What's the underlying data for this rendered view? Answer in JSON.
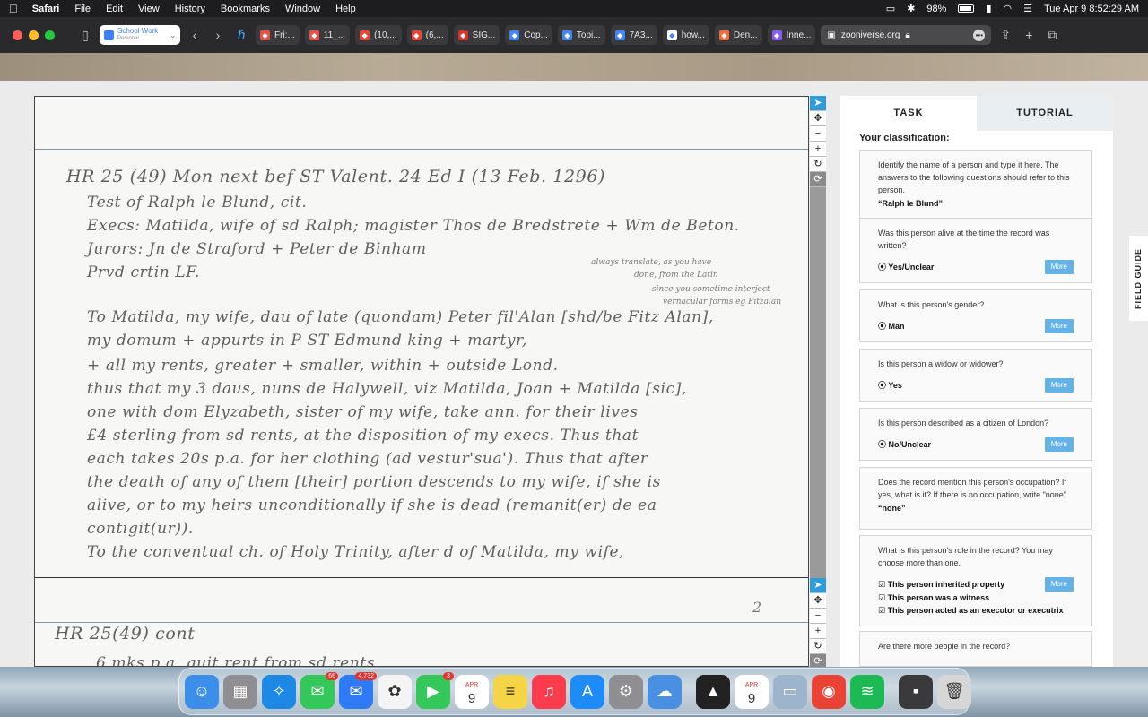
{
  "menubar": {
    "app": "Safari",
    "items": [
      "File",
      "Edit",
      "View",
      "History",
      "Bookmarks",
      "Window",
      "Help"
    ],
    "battery": "98%",
    "datetime": "Tue Apr 9  8:52:29 AM"
  },
  "toolbar": {
    "profile_name": "School Work",
    "profile_sub": "Personal",
    "tabs": [
      {
        "label": "Fri:...",
        "color": "#e8504a"
      },
      {
        "label": "11_...",
        "color": "#e8504a"
      },
      {
        "label": "(10,...",
        "color": "#ea4335"
      },
      {
        "label": "(6,...",
        "color": "#ea4335"
      },
      {
        "label": "SIG...",
        "color": "#d93025"
      },
      {
        "label": "Cop...",
        "color": "#4285f4"
      },
      {
        "label": "Topi...",
        "color": "#4285f4"
      },
      {
        "label": "7A3...",
        "color": "#4285f4"
      },
      {
        "label": "how...",
        "color": "#ffffff"
      },
      {
        "label": "Den...",
        "color": "#f26b3a"
      },
      {
        "label": "Inne...",
        "color": "#8a5cf6"
      }
    ],
    "url": "zooniverse.org"
  },
  "document": {
    "card1_lines": [
      "HR 25 (49)  Mon next bef ST Valent.   24 Ed I                       (13 Feb. 1296)",
      "Test of Ralph le Blund, cit.",
      "Execs: Matilda, wife of sd Ralph; magister Thos de Bredstrete + Wm de Beton.",
      "Jurors: Jn de Straford + Peter de Binham",
      "Prvd crtin LF.",
      "To Matilda, my wife, dau of late (quondam) Peter fil'Alan [shd/be Fitz Alan],",
      "my domum + appurts in P ST Edmund king + martyr,",
      "+ all my rents, greater + smaller, within + outside Lond.",
      "thus that my 3 daus, nuns de Halywell, viz Matilda, Joan + Matilda [sic],",
      "one with dom Elyzabeth, sister of my wife, take ann. for their lives",
      "£4 sterling from sd rents, at the disposition of my execs. Thus that",
      "each takes 20s p.a. for her clothing (ad vestur'sua').  Thus that after",
      "the death of any of them [their] portion descends to my wife, if she is",
      "alive, or to my heirs unconditionally if she is dead (remanit(er) de ea",
      "contigit(ur)).",
      "To the conventual ch. of Holy Trinity, after d of Matilda, my wife,"
    ],
    "margin_note": [
      "always translate, as you have",
      "done, from the Latin",
      "since you sometime interject",
      "vernacular forms eg Fitzalan"
    ],
    "card2_lines": [
      "HR 25(49)  cont",
      "6 mks p.a. quit rent from sd rents"
    ],
    "card2_page_number": "2"
  },
  "viewer_tools": [
    "pointer-icon",
    "move-icon",
    "zoom-out-icon",
    "zoom-in-icon",
    "rotate-icon",
    "reset-icon"
  ],
  "panel": {
    "tab_task": "TASK",
    "tab_tutorial": "TUTORIAL",
    "heading": "Your classification:",
    "questions": [
      {
        "text": "Identify the name of a person and type it here. The answers to the following questions should refer to this person.",
        "answer": "“Ralph le Blund”",
        "more": false
      },
      {
        "text": "Was this person alive at the time the record was written?",
        "answer": "Yes/Unclear",
        "more": true
      },
      {
        "text": "What is this person's gender?",
        "answer": "Man",
        "more": true
      },
      {
        "text": "Is this person a widow or widower?",
        "answer": "Yes",
        "more": true
      },
      {
        "text": "Is this person described as a citizen of London?",
        "answer": "No/Unclear",
        "more": true
      },
      {
        "text": "Does the record mention this person's occupation? If yes, what is it? If there is no occupation, write \"none\".",
        "answer": "“none”",
        "more": false
      },
      {
        "text": "What is this person's role in the record? You may choose more than one.",
        "answers": [
          "This person inherited property",
          "This person was a witness",
          "This person acted as an executor or executrix"
        ],
        "more": true
      },
      {
        "text": "Are there more people in the record?",
        "more": false
      }
    ],
    "more_label": "More",
    "field_guide": "FIELD GUIDE"
  },
  "dock": {
    "apps": [
      {
        "name": "finder-icon",
        "color": "#3b8fe8",
        "glyph": "☺"
      },
      {
        "name": "launchpad-icon",
        "color": "#8e8e93",
        "glyph": "▦"
      },
      {
        "name": "safari-icon",
        "color": "#1e88e5",
        "glyph": "✧"
      },
      {
        "name": "messages-icon",
        "color": "#34c759",
        "glyph": "✉",
        "badge": "66"
      },
      {
        "name": "mail-icon",
        "color": "#2f7bf5",
        "glyph": "✉",
        "badge": "4,732"
      },
      {
        "name": "photos-icon",
        "color": "#f4f4f4",
        "glyph": "✿"
      },
      {
        "name": "facetime-icon",
        "color": "#34c759",
        "glyph": "▶",
        "badge": "3"
      },
      {
        "name": "calendar-icon",
        "color": "#ffffff",
        "glyph": "9"
      },
      {
        "name": "notes-icon",
        "color": "#f5d547",
        "glyph": "≡"
      },
      {
        "name": "music-icon",
        "color": "#fa3c4c",
        "glyph": "♫"
      },
      {
        "name": "app-store-icon",
        "color": "#1d8cf8",
        "glyph": "A"
      },
      {
        "name": "system-settings-icon",
        "color": "#8e8e93",
        "glyph": "⚙"
      },
      {
        "name": "weather-icon",
        "color": "#4a90e2",
        "glyph": "☁"
      },
      {
        "name": "vlc-icon",
        "color": "#222222",
        "glyph": "▲"
      },
      {
        "name": "calendar-2-icon",
        "color": "#ffffff",
        "glyph": "9"
      },
      {
        "name": "preview-icon",
        "color": "#9cb4cc",
        "glyph": "▭"
      },
      {
        "name": "chrome-icon",
        "color": "#ea4335",
        "glyph": "◉"
      },
      {
        "name": "spotify-icon",
        "color": "#1db954",
        "glyph": "≋"
      },
      {
        "name": "window-icon",
        "color": "#3a3a3c",
        "glyph": "▪"
      },
      {
        "name": "trash-icon",
        "color": "#d6d6d6",
        "glyph": "🗑"
      }
    ],
    "calendar_month": "APR",
    "calendar_day": "9"
  }
}
